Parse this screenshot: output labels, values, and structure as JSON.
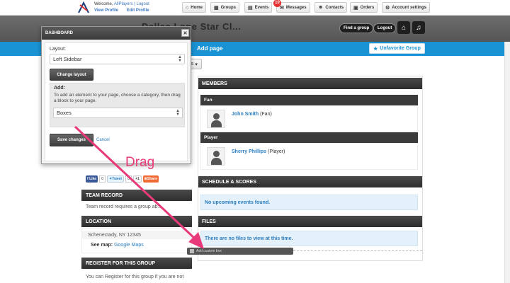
{
  "topbar": {
    "welcome_prefix": "Welcome, ",
    "welcome_user": "AllPlayers",
    "welcome_logout": " | Logout",
    "view_profile": "View Profile",
    "edit_profile": "Edit Profile",
    "nav": [
      {
        "label": "Home",
        "icon": "home-icon"
      },
      {
        "label": "Groups",
        "icon": "groups-icon"
      },
      {
        "label": "Events",
        "icon": "calendar-icon"
      },
      {
        "label": "Messages",
        "icon": "envelope-icon"
      },
      {
        "label": "Contacts",
        "icon": "contacts-icon"
      },
      {
        "label": "Orders",
        "icon": "cart-icon"
      },
      {
        "label": "Account settings",
        "icon": "gear-icon"
      }
    ],
    "messages_badge": "10"
  },
  "header": {
    "title": "Dallas Lone Star Cl...",
    "find_group": "Find a group",
    "logout": "Logout"
  },
  "bluebar": {
    "add_page": "Add page",
    "unfavorite": "Unfavorite Group"
  },
  "pages_button": "gs",
  "dashboard": {
    "title": "DASHBOARD",
    "close": "✕",
    "layout_label": "Layout:",
    "layout_value": "Left Sidebar",
    "change_layout": "Change layout",
    "add_title": "Add:",
    "add_desc": "To add an element to your page, choose a category, then drag a block to your page.",
    "category_value": "Boxes",
    "save": "Save changes",
    "cancel": "Cancel"
  },
  "drag_label": "Drag",
  "colors": {
    "accent": "#1a93d4",
    "annotation": "#e83a7a",
    "header_dark": "#2e2e2e"
  },
  "main": {
    "members_title": "MEMBERS",
    "groups": [
      {
        "role": "Fan",
        "name": "John Smith",
        "tag": "(Fan)"
      },
      {
        "role": "Player",
        "name": "Sherry Phillips",
        "tag": "(Player)"
      }
    ],
    "schedule_title": "SCHEDULE & SCORES",
    "schedule_empty": "No upcoming events found.",
    "files_title": "FILES",
    "files_empty": "There are no files to view at this time.",
    "add_custom_box": "Add custom box"
  },
  "sidebar": {
    "social": {
      "like": "Like",
      "like_count": "0",
      "tweet": "Tweet",
      "tweet_count": "0",
      "gplus": "+1",
      "share": "Share"
    },
    "team_record_title": "TEAM RECORD",
    "team_record_text": "Team record requires a group ab...",
    "location_title": "LOCATION",
    "location_city": "Schenectady, NY 12345",
    "see_map_label": "See map:",
    "see_map_link": "Google Maps",
    "register_title": "REGISTER FOR THIS GROUP",
    "register_text": "You can Register for this group if you are not"
  }
}
